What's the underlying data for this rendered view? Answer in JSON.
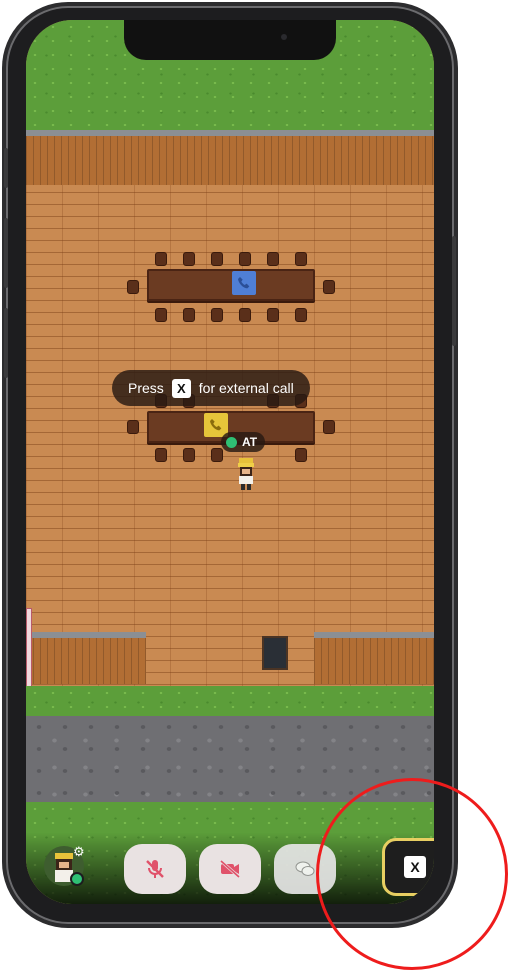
{
  "call_prompt": {
    "prefix": "Press",
    "key": "X",
    "suffix": "for external call"
  },
  "player": {
    "initials": "AT",
    "status_color": "#2fc074"
  },
  "controls": {
    "mic": {
      "icon": "mic-off-icon",
      "state": "off"
    },
    "camera": {
      "icon": "camera-off-icon",
      "state": "off"
    },
    "chat": {
      "icon": "chat-icon"
    },
    "external_call_key": "X"
  },
  "colors": {
    "highlight_ring": "#ee1c1c",
    "call_button_border": "#e8cf62",
    "mute_red": "#e0526a",
    "phone_blue": "#4f7fd6",
    "phone_yellow": "#e6c53a"
  }
}
